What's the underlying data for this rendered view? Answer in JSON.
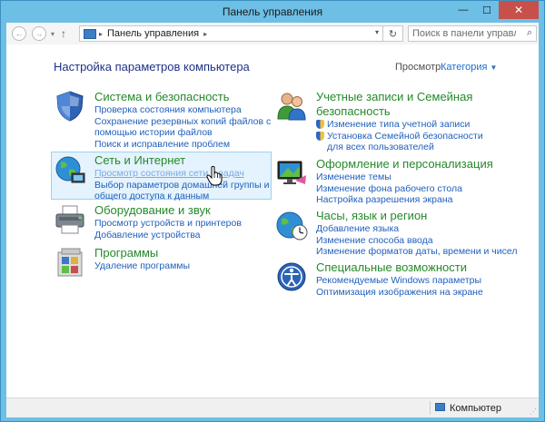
{
  "window": {
    "title": "Панель управления",
    "minimize": "—",
    "maximize": "☐",
    "close": "✕"
  },
  "nav": {
    "back": "←",
    "forward": "→",
    "history": "▾",
    "up": "↑",
    "address_sep": "▸",
    "address_label": "Панель управления",
    "address_trail": "▸",
    "address_dropdown": "▾",
    "refresh": "↻",
    "search_placeholder": "Поиск в панели управления",
    "search_glyph": "⌕"
  },
  "header": {
    "title": "Настройка параметров компьютера",
    "view_by_label": "Просмотр:",
    "view_by_value": "Категория",
    "view_by_caret": "▼"
  },
  "categories": [
    {
      "title": "Система и безопасность",
      "icon": "shield-icon",
      "links": [
        "Проверка состояния компьютера",
        "Сохранение резервных копий файлов с помощью истории файлов",
        "Поиск и исправление проблем"
      ]
    },
    {
      "title": "Сеть и Интернет",
      "icon": "network-globe-icon",
      "links": [
        "Просмотр состояния сети и задач",
        "Выбор параметров домашней группы и общего доступа к данным"
      ]
    },
    {
      "title": "Оборудование и звук",
      "icon": "printer-icon",
      "links": [
        "Просмотр устройств и принтеров",
        "Добавление устройства"
      ]
    },
    {
      "title": "Программы",
      "icon": "programs-icon",
      "links": [
        "Удаление программы"
      ]
    },
    {
      "title": "Учетные записи и Семейная безопасность",
      "icon": "users-icon",
      "links": [
        "Изменение типа учетной записи",
        "Установка Семейной безопасности для всех пользователей"
      ]
    },
    {
      "title": "Оформление и персонализация",
      "icon": "monitor-palette-icon",
      "links": [
        "Изменение темы",
        "Изменение фона рабочего стола",
        "Настройка разрешения экрана"
      ]
    },
    {
      "title": "Часы, язык и регион",
      "icon": "globe-clock-icon",
      "links": [
        "Добавление языка",
        "Изменение способа ввода",
        "Изменение форматов даты, времени и чисел"
      ]
    },
    {
      "title": "Специальные возможности",
      "icon": "accessibility-icon",
      "links": [
        "Рекомендуемые Windows параметры",
        "Оптимизация изображения на экране"
      ]
    }
  ],
  "status": {
    "location": "Компьютер",
    "grip": "⋰"
  },
  "colors": {
    "frame": "#6dbfe6",
    "category_title": "#25892a",
    "link": "#1f5fbd",
    "page_title": "#1e3287",
    "selected_bg": "#e4f3fd"
  }
}
